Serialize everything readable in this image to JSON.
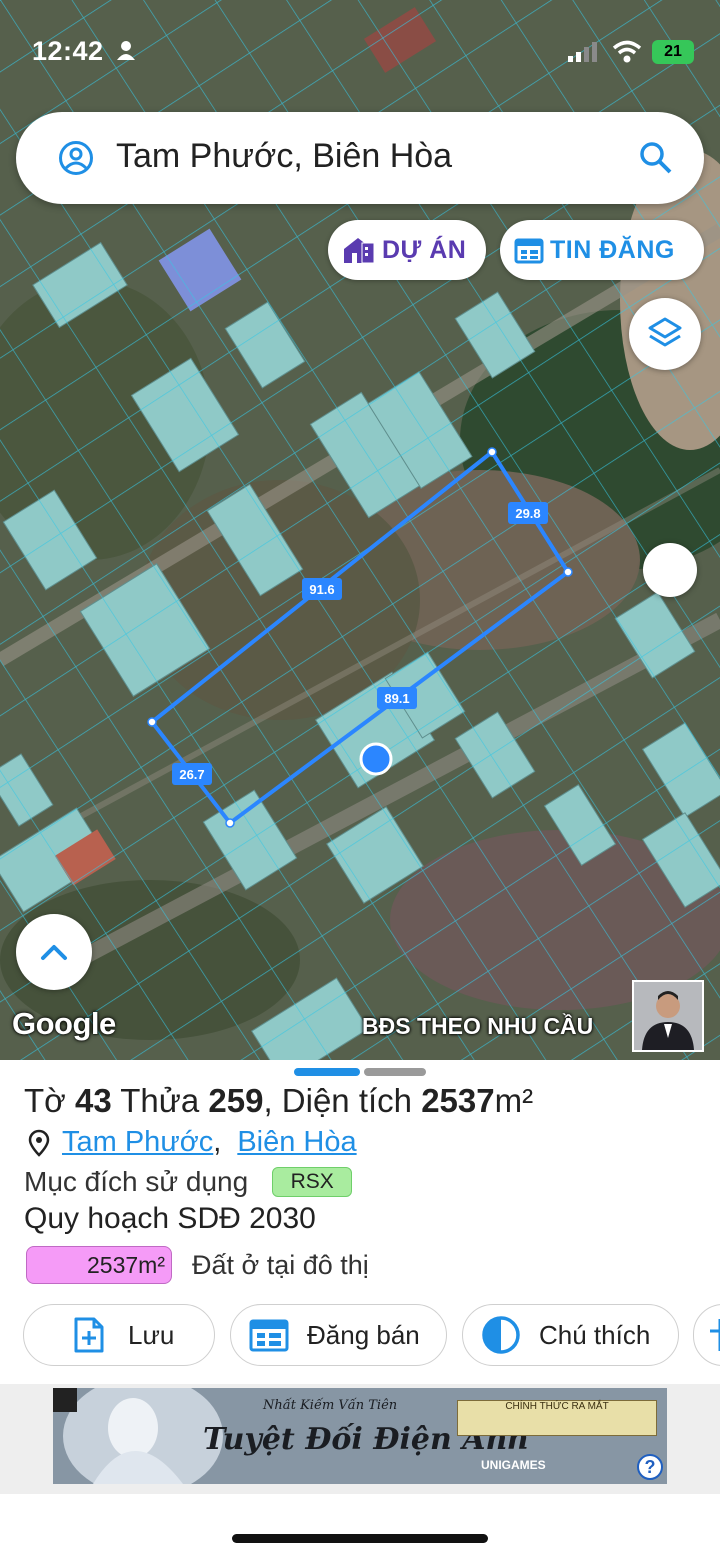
{
  "status_bar": {
    "time": "12:42",
    "battery": "21"
  },
  "search": {
    "query": "Tam Phước, Biên Hòa"
  },
  "map": {
    "chips": {
      "du_an": "DỰ ÁN",
      "tin_dang": "TIN ĐĂNG"
    },
    "measurements": {
      "top_edge": "91.6",
      "right_edge": "29.8",
      "bottom_edge": "89.1",
      "left_edge": "26.7"
    },
    "google_logo": "Google",
    "watermark": "BĐS  THEO NHU CẦU"
  },
  "parcel": {
    "title_prefix": "Tờ ",
    "sheet_no": "43",
    "title_mid": " Thửa ",
    "parcel_no": "259",
    "title_area_label": ", Diện tích ",
    "area": "2537",
    "area_unit": "m²",
    "ward": "Tam Phước",
    "city": "Biên Hòa",
    "purpose_label": "Mục đích sử dụng",
    "purpose_code": "RSX",
    "plan_label": "Quy hoạch SDĐ 2030",
    "plan_area": "2537m²",
    "plan_type": "Đất ở tại đô thị",
    "plan_color": "#f59bf7",
    "purpose_color": "#a9ec9f"
  },
  "actions": {
    "save": "Lưu",
    "post_sale": "Đăng bán",
    "legend": "Chú thích"
  },
  "ad": {
    "title": "Tuyệt Đối Điện Ảnh",
    "subtitle": "Nhất Kiếm Vấn Tiên",
    "cta": "CHÍNH THỨC RA MẮT",
    "brand": "UNIGAMES"
  },
  "colors": {
    "accent": "#1f8fe5",
    "project": "#5a3bb0",
    "parcel_outline": "#2b86ff"
  }
}
